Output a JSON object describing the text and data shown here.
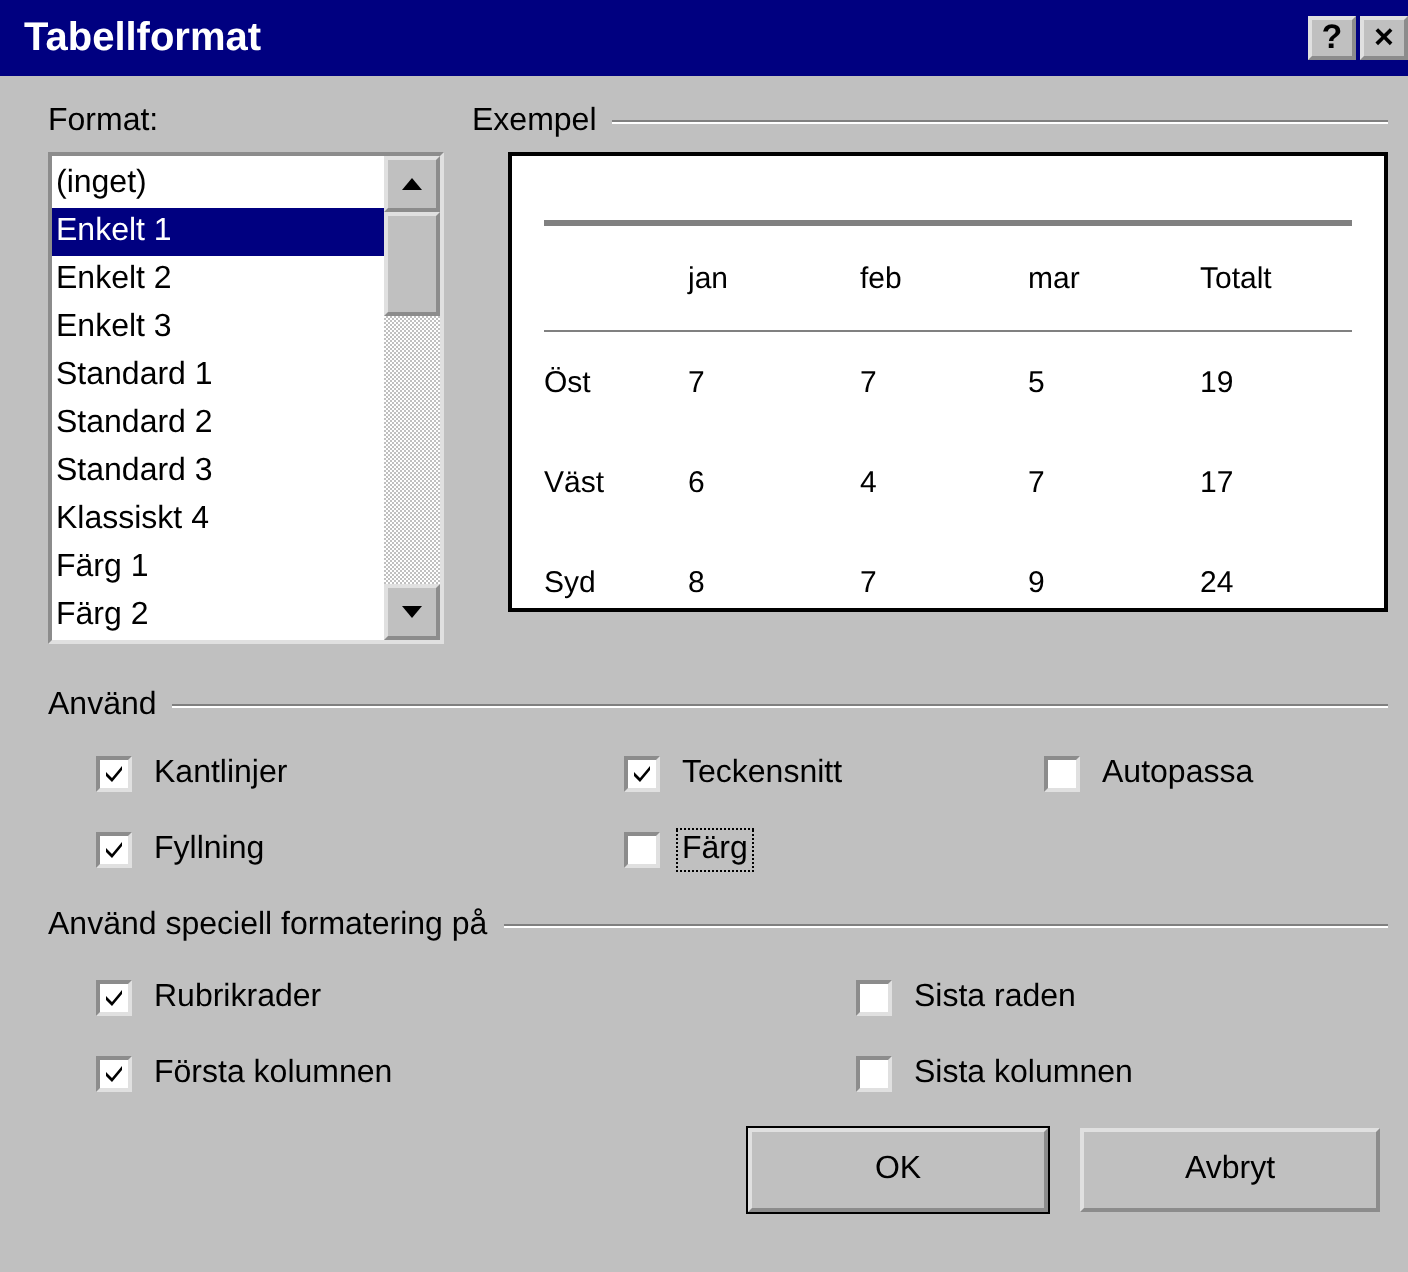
{
  "window": {
    "title": "Tabellformat",
    "title_buttons": [
      "?",
      "×"
    ]
  },
  "format": {
    "label": "Format:",
    "items": [
      {
        "label": "(inget)",
        "selected": false
      },
      {
        "label": "Enkelt 1",
        "selected": true
      },
      {
        "label": "Enkelt 2",
        "selected": false
      },
      {
        "label": "Enkelt 3",
        "selected": false
      },
      {
        "label": "Standard 1",
        "selected": false
      },
      {
        "label": "Standard 2",
        "selected": false
      },
      {
        "label": "Standard 3",
        "selected": false
      },
      {
        "label": "Klassiskt 4",
        "selected": false
      },
      {
        "label": "Färg 1",
        "selected": false
      },
      {
        "label": "Färg 2",
        "selected": false
      }
    ]
  },
  "example": {
    "label": "Exempel",
    "columns": [
      "",
      "jan",
      "feb",
      "mar",
      "Totalt"
    ],
    "rows": [
      [
        "Öst",
        "7",
        "7",
        "5",
        "19"
      ],
      [
        "Väst",
        "6",
        "4",
        "7",
        "17"
      ],
      [
        "Syd",
        "8",
        "7",
        "9",
        "24"
      ]
    ]
  },
  "apply": {
    "label": "Använd",
    "options": [
      {
        "label": "Kantlinjer",
        "checked": true,
        "focused": false
      },
      {
        "label": "Teckensnitt",
        "checked": true,
        "focused": false
      },
      {
        "label": "Autopassa",
        "checked": false,
        "focused": false
      },
      {
        "label": "Fyllning",
        "checked": true,
        "focused": false
      },
      {
        "label": "Färg",
        "checked": false,
        "focused": true
      }
    ]
  },
  "special": {
    "label": "Använd speciell formatering på",
    "options": [
      {
        "label": "Rubrikrader",
        "checked": true
      },
      {
        "label": "Sista raden",
        "checked": false
      },
      {
        "label": "Första kolumnen",
        "checked": true
      },
      {
        "label": "Sista kolumnen",
        "checked": false
      }
    ]
  },
  "buttons": [
    "OK",
    "Avbryt"
  ]
}
